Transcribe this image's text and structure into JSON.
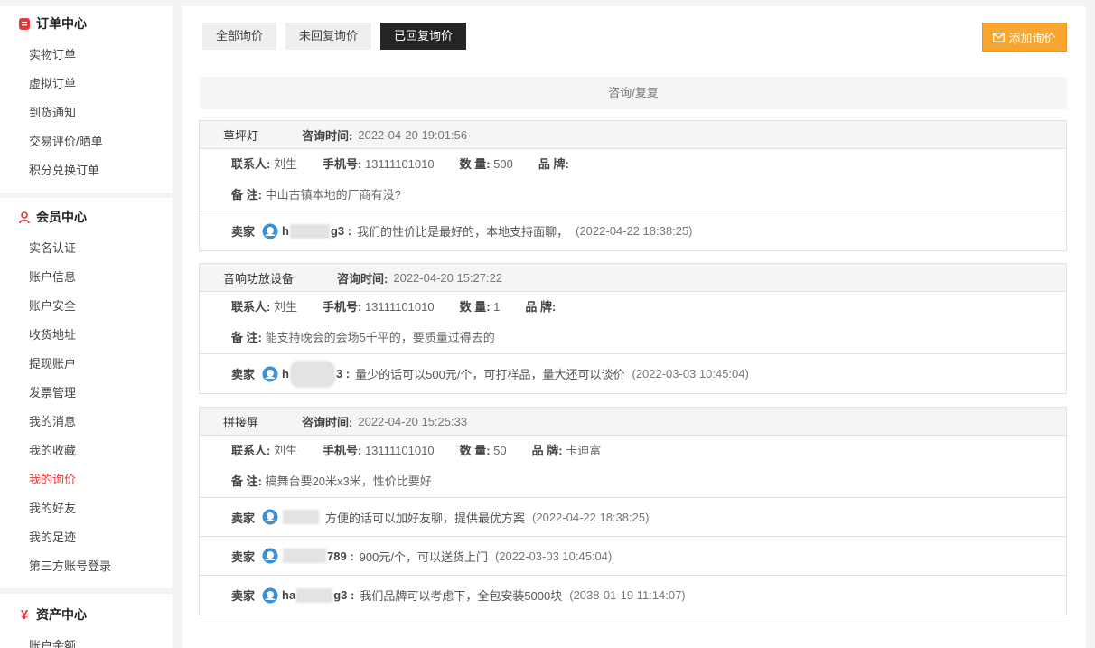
{
  "sidebar": {
    "sections": [
      {
        "title": "订单中心",
        "items": [
          "实物订单",
          "虚拟订单",
          "到货通知",
          "交易评价/晒单",
          "积分兑换订单"
        ]
      },
      {
        "title": "会员中心",
        "items": [
          "实名认证",
          "账户信息",
          "账户安全",
          "收货地址",
          "提现账户",
          "发票管理",
          "我的消息",
          "我的收藏",
          "我的询价",
          "我的好友",
          "我的足迹",
          "第三方账号登录"
        ]
      },
      {
        "title": "资产中心",
        "items": [
          "账户余额"
        ]
      }
    ]
  },
  "tabs": [
    "全部询价",
    "未回复询价",
    "已回复询价"
  ],
  "add_button": "添加询价",
  "column_header": "咨询/复复",
  "labels": {
    "ask_time": "咨询时间:",
    "contact": "联系人:",
    "phone": "手机号:",
    "qty": "数 量:",
    "brand": "品 牌:",
    "remark": "备 注:",
    "seller": "卖家"
  },
  "inquiries": [
    {
      "product": "草坪灯",
      "time": "2022-04-20 19:01:56",
      "contact": "刘生",
      "phone": "13111101010",
      "qty": "500",
      "brand": "",
      "remark": "中山古镇本地的厂商有没?",
      "replies": [
        {
          "name_start": "h",
          "name_end": "g3 :",
          "text": "我们的性价比是最好的，本地支持面聊，",
          "time": "(2022-04-22 18:38:25)"
        }
      ]
    },
    {
      "product": "音响功放设备",
      "time": "2022-04-20 15:27:22",
      "contact": "刘生",
      "phone": "13111101010",
      "qty": "1",
      "brand": "",
      "remark": "能支持晚会的会场5千平的，要质量过得去的",
      "replies": [
        {
          "name_start": "h",
          "name_end": "3 :",
          "text": "量少的话可以500元/个，可打样品，量大还可以谈价",
          "time": "(2022-03-03 10:45:04)"
        }
      ]
    },
    {
      "product": "拼接屏",
      "time": "2022-04-20 15:25:33",
      "contact": "刘生",
      "phone": "13111101010",
      "qty": "50",
      "brand": "卡迪富",
      "remark": "搞舞台要20米x3米，性价比要好",
      "replies": [
        {
          "name_start": "",
          "name_end": "",
          "text": "方便的话可以加好友聊，提供最优方案",
          "time": "(2022-04-22 18:38:25)"
        },
        {
          "name_start": "",
          "name_end": "789 :",
          "text": "900元/个，可以送货上门",
          "time": "(2022-03-03 10:45:04)"
        },
        {
          "name_start": "ha",
          "name_end": "g3 :",
          "text": "我们品牌可以考虑下，全包安装5000块",
          "time": "(2038-01-19 11:14:07)"
        }
      ]
    }
  ]
}
